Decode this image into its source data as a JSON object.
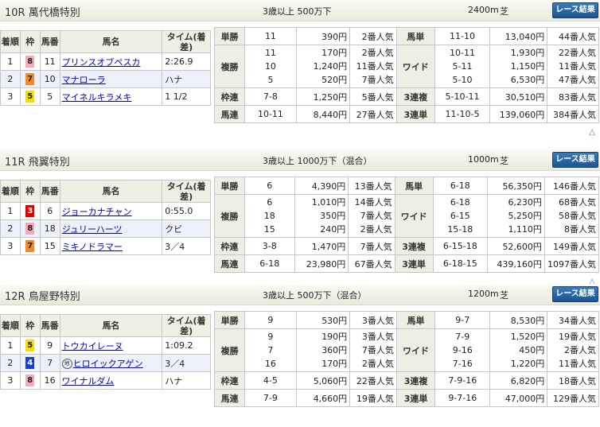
{
  "races": [
    {
      "title": "10R 萬代橋特別",
      "age_class": "3歳以上 500万下",
      "distance": "2400m",
      "surface": "芝",
      "button": "レース結果",
      "columns": [
        "着順",
        "枠",
        "馬番",
        "馬名",
        "タイム(着差)"
      ],
      "results": [
        {
          "pos": "1",
          "waku": "8",
          "num": "11",
          "name": "プリンスオブペスカ",
          "time": "2:26.9"
        },
        {
          "pos": "2",
          "waku": "7",
          "num": "10",
          "name": "マナローラ",
          "time": "ハナ"
        },
        {
          "pos": "3",
          "waku": "5",
          "num": "5",
          "name": "マイネルキラメキ",
          "time": "1 1/2"
        }
      ],
      "payouts": {
        "tansho": {
          "label": "単勝",
          "nums": [
            "11"
          ],
          "yens": [
            "390円"
          ],
          "pops": [
            "2番人気"
          ]
        },
        "umatan": {
          "label": "馬単",
          "nums": [
            "11-10"
          ],
          "yens": [
            "13,040円"
          ],
          "pops": [
            "44番人気"
          ]
        },
        "fukusho": {
          "label": "複勝",
          "nums": [
            "11",
            "10",
            "5"
          ],
          "yens": [
            "170円",
            "1,240円",
            "520円"
          ],
          "pops": [
            "2番人気",
            "11番人気",
            "7番人気"
          ]
        },
        "wide": {
          "label": "ワイド",
          "nums": [
            "10-11",
            "5-11",
            "5-10"
          ],
          "yens": [
            "1,930円",
            "1,150円",
            "6,530円"
          ],
          "pops": [
            "22番人気",
            "11番人気",
            "47番人気"
          ]
        },
        "wakuren": {
          "label": "枠連",
          "nums": [
            "7-8"
          ],
          "yens": [
            "1,250円"
          ],
          "pops": [
            "5番人気"
          ]
        },
        "sanrenpuku": {
          "label": "3連複",
          "nums": [
            "5-10-11"
          ],
          "yens": [
            "30,510円"
          ],
          "pops": [
            "83番人気"
          ]
        },
        "umaren": {
          "label": "馬連",
          "nums": [
            "10-11"
          ],
          "yens": [
            "8,440円"
          ],
          "pops": [
            "27番人気"
          ]
        },
        "sanrentan": {
          "label": "3連単",
          "nums": [
            "11-10-5"
          ],
          "yens": [
            "139,060円"
          ],
          "pops": [
            "384番人気"
          ]
        }
      }
    },
    {
      "title": "11R 飛翼特別",
      "age_class": "3歳以上 1000万下（混合）",
      "distance": "1000m",
      "surface": "芝",
      "button": "レース結果",
      "columns": [
        "着順",
        "枠",
        "馬番",
        "馬名",
        "タイム(着差)"
      ],
      "results": [
        {
          "pos": "1",
          "waku": "3",
          "num": "6",
          "name": "ジョーカナチャン",
          "time": "0:55.0"
        },
        {
          "pos": "2",
          "waku": "8",
          "num": "18",
          "name": "ジュリーハーツ",
          "time": "クビ"
        },
        {
          "pos": "3",
          "waku": "7",
          "num": "15",
          "name": "ミキノドラマー",
          "time": "3／4"
        }
      ],
      "payouts": {
        "tansho": {
          "label": "単勝",
          "nums": [
            "6"
          ],
          "yens": [
            "4,390円"
          ],
          "pops": [
            "13番人気"
          ]
        },
        "umatan": {
          "label": "馬単",
          "nums": [
            "6-18"
          ],
          "yens": [
            "56,350円"
          ],
          "pops": [
            "146番人気"
          ]
        },
        "fukusho": {
          "label": "複勝",
          "nums": [
            "6",
            "18",
            "15"
          ],
          "yens": [
            "1,010円",
            "350円",
            "240円"
          ],
          "pops": [
            "14番人気",
            "7番人気",
            "2番人気"
          ]
        },
        "wide": {
          "label": "ワイド",
          "nums": [
            "6-18",
            "6-15",
            "15-18"
          ],
          "yens": [
            "6,230円",
            "5,250円",
            "1,110円"
          ],
          "pops": [
            "68番人気",
            "58番人気",
            "8番人気"
          ]
        },
        "wakuren": {
          "label": "枠連",
          "nums": [
            "3-8"
          ],
          "yens": [
            "1,470円"
          ],
          "pops": [
            "7番人気"
          ]
        },
        "sanrenpuku": {
          "label": "3連複",
          "nums": [
            "6-15-18"
          ],
          "yens": [
            "52,600円"
          ],
          "pops": [
            "149番人気"
          ]
        },
        "umaren": {
          "label": "馬連",
          "nums": [
            "6-18"
          ],
          "yens": [
            "23,980円"
          ],
          "pops": [
            "67番人気"
          ]
        },
        "sanrentan": {
          "label": "3連単",
          "nums": [
            "6-18-15"
          ],
          "yens": [
            "439,160円"
          ],
          "pops": [
            "1097番人気"
          ]
        }
      }
    },
    {
      "title": "12R 鳥屋野特別",
      "age_class": "3歳以上 500万下（混合）",
      "distance": "1200m",
      "surface": "芝",
      "button": "レース結果",
      "columns": [
        "着順",
        "枠",
        "馬番",
        "馬名",
        "タイム(着差)"
      ],
      "results": [
        {
          "pos": "1",
          "waku": "5",
          "num": "9",
          "name": "トウカイレーヌ",
          "time": "1:09.2"
        },
        {
          "pos": "2",
          "waku": "4",
          "num": "7",
          "name": "ヒロイックアゲン",
          "time": "3／4",
          "mark": "地"
        },
        {
          "pos": "3",
          "waku": "8",
          "num": "16",
          "name": "ワイナルダム",
          "time": "ハナ"
        }
      ],
      "payouts": {
        "tansho": {
          "label": "単勝",
          "nums": [
            "9"
          ],
          "yens": [
            "530円"
          ],
          "pops": [
            "3番人気"
          ]
        },
        "umatan": {
          "label": "馬単",
          "nums": [
            "9-7"
          ],
          "yens": [
            "8,530円"
          ],
          "pops": [
            "34番人気"
          ]
        },
        "fukusho": {
          "label": "複勝",
          "nums": [
            "9",
            "7",
            "16"
          ],
          "yens": [
            "190円",
            "360円",
            "170円"
          ],
          "pops": [
            "3番人気",
            "7番人気",
            "2番人気"
          ]
        },
        "wide": {
          "label": "ワイド",
          "nums": [
            "7-9",
            "9-16",
            "7-16"
          ],
          "yens": [
            "1,520円",
            "450円",
            "1,220円"
          ],
          "pops": [
            "19番人気",
            "2番人気",
            "11番人気"
          ]
        },
        "wakuren": {
          "label": "枠連",
          "nums": [
            "4-5"
          ],
          "yens": [
            "5,060円"
          ],
          "pops": [
            "22番人気"
          ]
        },
        "sanrenpuku": {
          "label": "3連複",
          "nums": [
            "7-9-16"
          ],
          "yens": [
            "6,820円"
          ],
          "pops": [
            "18番人気"
          ]
        },
        "umaren": {
          "label": "馬連",
          "nums": [
            "7-9"
          ],
          "yens": [
            "4,660円"
          ],
          "pops": [
            "19番人気"
          ]
        },
        "sanrentan": {
          "label": "3連単",
          "nums": [
            "9-7-16"
          ],
          "yens": [
            "47,000円"
          ],
          "pops": [
            "129番人気"
          ]
        }
      }
    }
  ],
  "waku_colors": {
    "3": "#e00000",
    "4": "#1a3fd0",
    "5": "#f0e000",
    "7": "#f08c28",
    "8": "#f4a8b8"
  },
  "waku_text": {
    "3": "#ffffff",
    "4": "#ffffff",
    "5": "#222222",
    "7": "#222222",
    "8": "#222222"
  },
  "icons": {
    "page_top": "up-triangle-icon",
    "local_mark": "circle-mark-icon"
  }
}
